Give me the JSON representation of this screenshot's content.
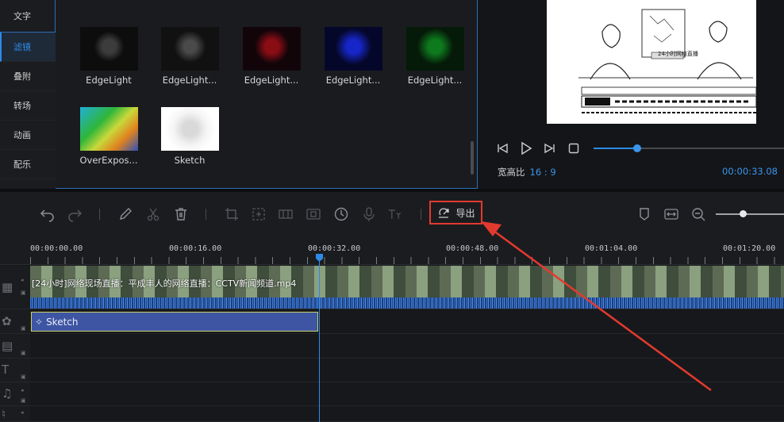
{
  "sidebar": {
    "items": [
      {
        "label": "文字",
        "active": false
      },
      {
        "label": "滤镜",
        "active": true
      },
      {
        "label": "叠附",
        "active": false
      },
      {
        "label": "转场",
        "active": false
      },
      {
        "label": "动画",
        "active": false
      },
      {
        "label": "配乐",
        "active": false
      }
    ]
  },
  "filters": {
    "items": [
      {
        "label": "EdgeLight"
      },
      {
        "label": "EdgeLight..."
      },
      {
        "label": "EdgeLight..."
      },
      {
        "label": "EdgeLight..."
      },
      {
        "label": "EdgeLight..."
      },
      {
        "label": "OverExpos..."
      },
      {
        "label": "Sketch"
      }
    ]
  },
  "preview": {
    "aspect_label": "宽高比",
    "aspect_value": "16 : 9",
    "duration": "00:00:33.08",
    "progress": 0.23,
    "frame_caption": "24小时网络直播"
  },
  "toolbar": {
    "export_label": "导出",
    "zoom_level": 0.4
  },
  "timeline": {
    "ruler_labels": [
      "00:00:00.00",
      "00:00:16.00",
      "00:00:32.00",
      "00:00:48.00",
      "00:01:04.00",
      "00:01:20.00"
    ],
    "video_clip_name": "[24小时]网络现场直播：平成丰人的网络直播：CCTV新闻频道.mp4",
    "filter_clip_name": "Sketch"
  },
  "colors": {
    "accent": "#2e8ae6",
    "highlight_box": "#e23a2e",
    "filter_clip": "#3e55a3"
  }
}
